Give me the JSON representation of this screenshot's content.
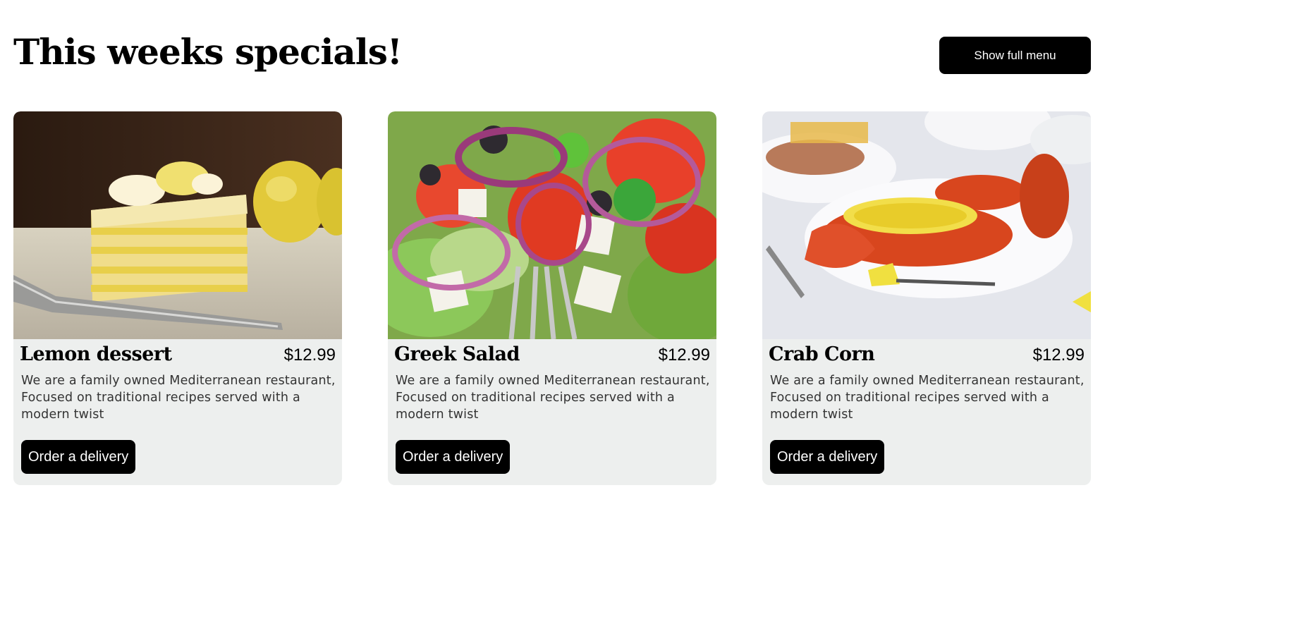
{
  "header": {
    "title": "This weeks specials!",
    "menu_button": "Show full menu"
  },
  "colors": {
    "card_bg": "#edefee",
    "button_bg": "#000000",
    "button_text": "#ffffff"
  },
  "specials": [
    {
      "name": "Lemon dessert",
      "price": "$12.99",
      "description": "We are a family owned Mediterranean restaurant, Focused on traditional recipes served with a modern twist",
      "order_label": "Order a delivery"
    },
    {
      "name": "Greek Salad",
      "price": "$12.99",
      "description": "We are a family owned Mediterranean restaurant, Focused on traditional recipes served with a modern twist",
      "order_label": "Order a delivery"
    },
    {
      "name": "Crab Corn",
      "price": "$12.99",
      "description": "We are a family owned Mediterranean restaurant, Focused on traditional recipes served with a modern twist",
      "order_label": "Order a delivery"
    }
  ]
}
